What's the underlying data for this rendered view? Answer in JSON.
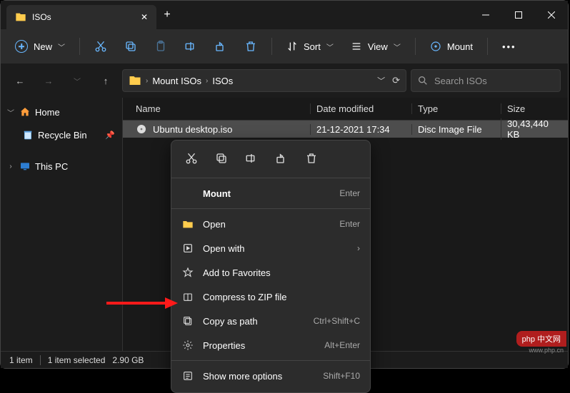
{
  "tab": {
    "title": "ISOs"
  },
  "toolbar": {
    "new": "New",
    "sort": "Sort",
    "view": "View",
    "mount": "Mount"
  },
  "breadcrumb": [
    "Mount ISOs",
    "ISOs"
  ],
  "search": {
    "placeholder": "Search ISOs"
  },
  "sidebar": {
    "home": "Home",
    "recycle": "Recycle Bin",
    "thispc": "This PC"
  },
  "columns": {
    "name": "Name",
    "date": "Date modified",
    "type": "Type",
    "size": "Size"
  },
  "file": {
    "name": "Ubuntu desktop.iso",
    "date": "21-12-2021 17:34",
    "type": "Disc Image File",
    "size": "30,43,440 KB"
  },
  "context": {
    "mount": "Mount",
    "mount_hint": "Enter",
    "open": "Open",
    "open_hint": "Enter",
    "openwith": "Open with",
    "fav": "Add to Favorites",
    "zip": "Compress to ZIP file",
    "copypath": "Copy as path",
    "copypath_hint": "Ctrl+Shift+C",
    "props": "Properties",
    "props_hint": "Alt+Enter",
    "more": "Show more options",
    "more_hint": "Shift+F10"
  },
  "status": {
    "count": "1 item",
    "selected": "1 item selected",
    "size": "2.90 GB"
  },
  "watermark": {
    "text": "php 中文网",
    "sub": "www.php.cn"
  }
}
